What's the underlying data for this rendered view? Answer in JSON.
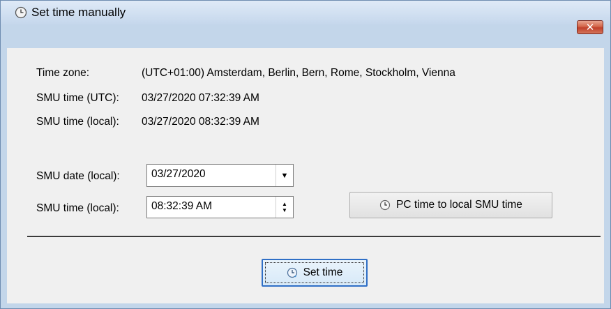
{
  "window": {
    "title": "Set time manually",
    "close_label": "✕",
    "title_icon": "clock-icon"
  },
  "info": {
    "timezone_label": "Time zone:",
    "timezone_value": "(UTC+01:00) Amsterdam, Berlin, Bern, Rome, Stockholm, Vienna",
    "smu_utc_label": "SMU time (UTC):",
    "smu_utc_value": "03/27/2020 07:32:39 AM",
    "smu_local_label": "SMU time (local):",
    "smu_local_value": "03/27/2020 08:32:39 AM"
  },
  "form": {
    "date_label": "SMU date (local):",
    "date_value": "03/27/2020",
    "time_label": "SMU time (local):",
    "time_value": "08:32:39 AM",
    "pc_time_button": "PC time to local SMU time"
  },
  "footer": {
    "set_time_button": "Set time"
  },
  "colors": {
    "title_bar": "#c5d7ec",
    "client_bg": "#f0f0f0",
    "close_button": "#c0402a",
    "focus_border": "#2f6fc6"
  }
}
